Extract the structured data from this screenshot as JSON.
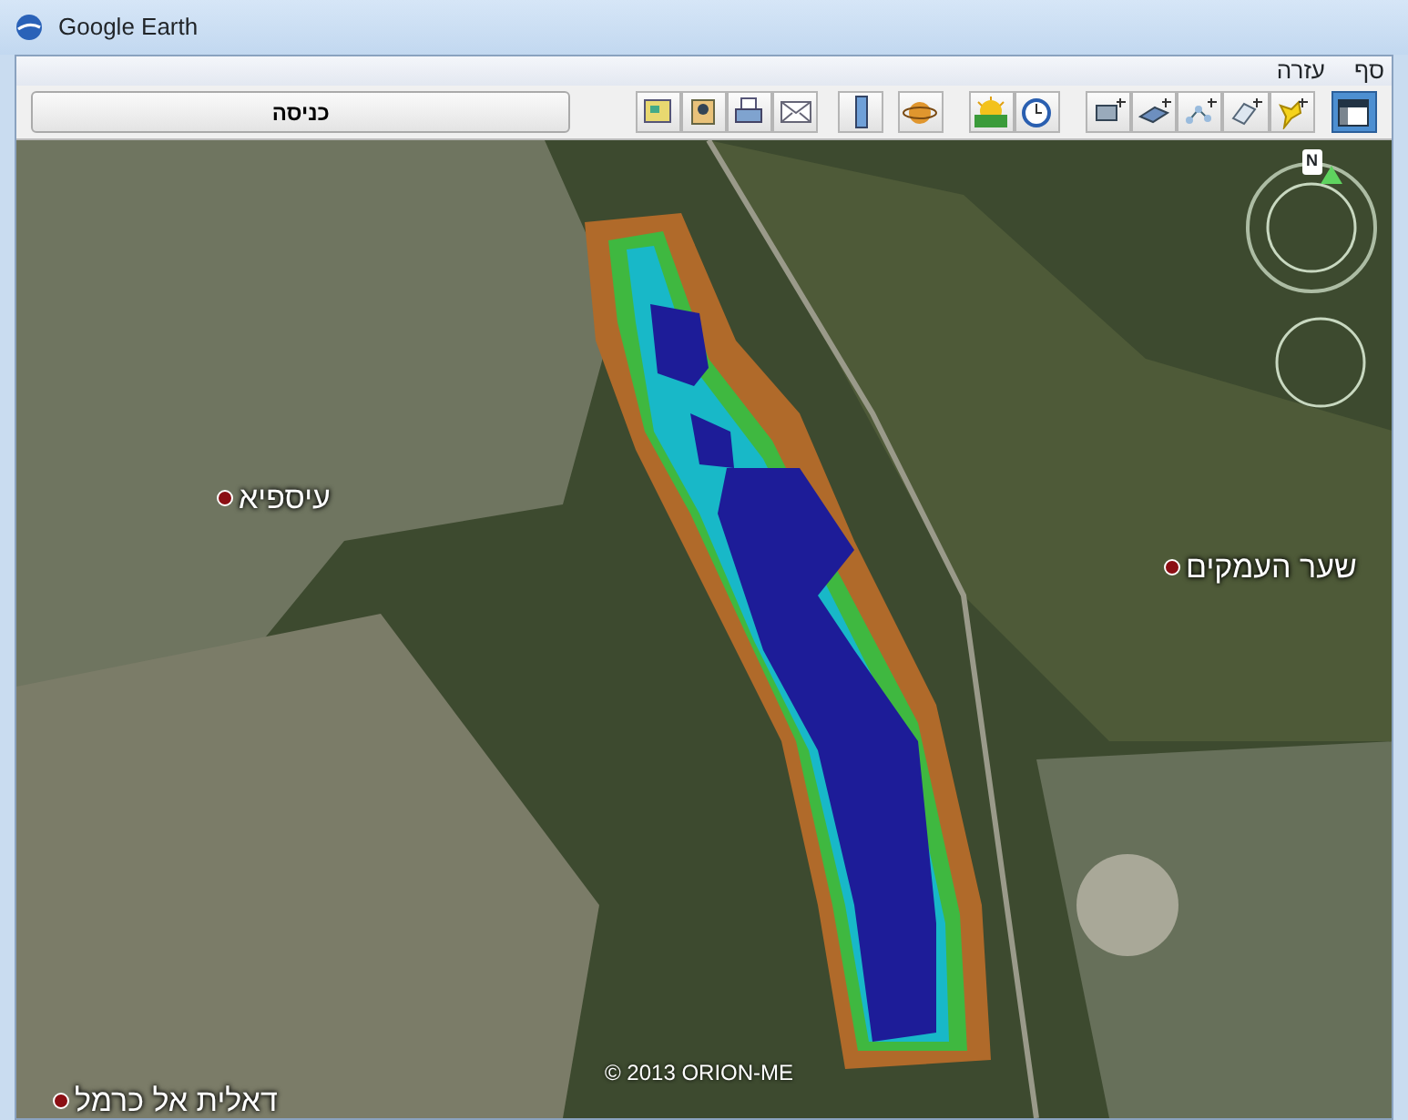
{
  "window": {
    "title": "Google Earth"
  },
  "menu": [
    {
      "label": "סף"
    },
    {
      "label": "עזרה"
    }
  ],
  "toolbar": {
    "search_button": "כניסה",
    "sidebar_toggle": {
      "selected": true
    }
  },
  "map": {
    "compass": "N",
    "places": [
      {
        "name": "עיספיא"
      },
      {
        "name": "שער העמקים"
      },
      {
        "name": "דאלית אל כרמל"
      }
    ],
    "copyright": "© 2013 ORION-ME"
  }
}
